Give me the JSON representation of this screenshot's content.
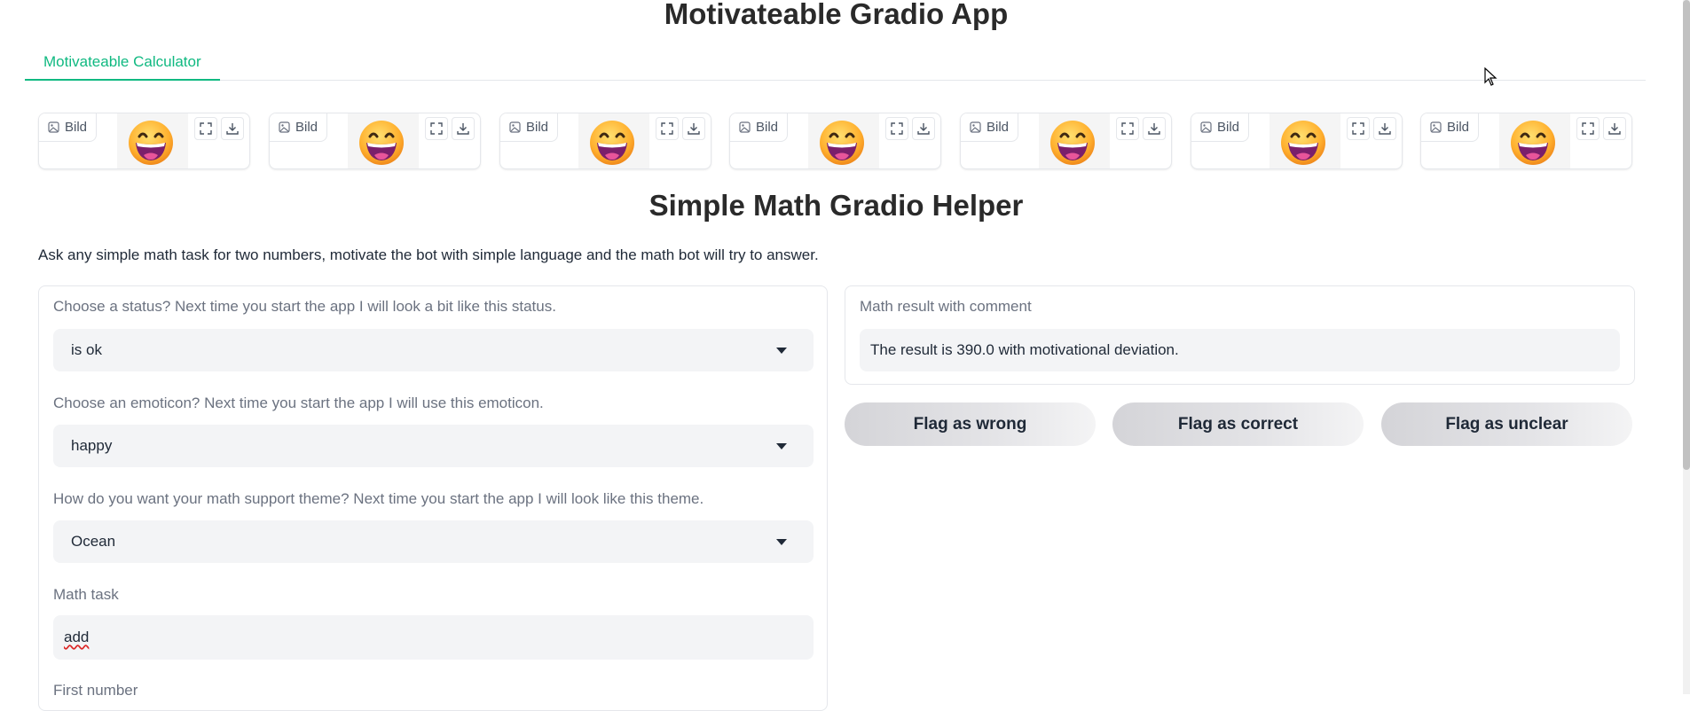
{
  "app": {
    "title": "Motivateable Gradio App"
  },
  "tabs": [
    {
      "label": "Motivateable Calculator"
    }
  ],
  "gallery": {
    "badge_label": "Bild",
    "items": [
      {
        "icon": "grinning-face-icon"
      },
      {
        "icon": "grinning-face-icon"
      },
      {
        "icon": "grinning-face-icon"
      },
      {
        "icon": "grinning-face-icon"
      },
      {
        "icon": "grinning-face-icon"
      },
      {
        "icon": "grinning-face-icon"
      },
      {
        "icon": "grinning-face-icon"
      }
    ]
  },
  "main": {
    "title": "Simple Math Gradio Helper",
    "description": "Ask any simple math task for two numbers, motivate the bot with simple language and the math bot will try to answer."
  },
  "form": {
    "status": {
      "label": "Choose a status? Next time you start the app I will look a bit like this status.",
      "value": "is ok"
    },
    "emoticon": {
      "label": "Choose an emoticon? Next time you start the app I will use this emoticon.",
      "value": "happy"
    },
    "theme": {
      "label": "How do you want your math support theme? Next time you start the app I will look like this theme.",
      "value": "Ocean"
    },
    "math_task": {
      "label": "Math task",
      "value": "add"
    },
    "first_number": {
      "label": "First number"
    }
  },
  "result": {
    "label": "Math result with comment",
    "value": "The result is 390.0 with motivational deviation."
  },
  "flags": {
    "wrong": "Flag as wrong",
    "correct": "Flag as correct",
    "unclear": "Flag as unclear"
  },
  "colors": {
    "accent": "#10b981",
    "panel_bg": "#f3f4f6",
    "border": "#e5e7eb"
  }
}
